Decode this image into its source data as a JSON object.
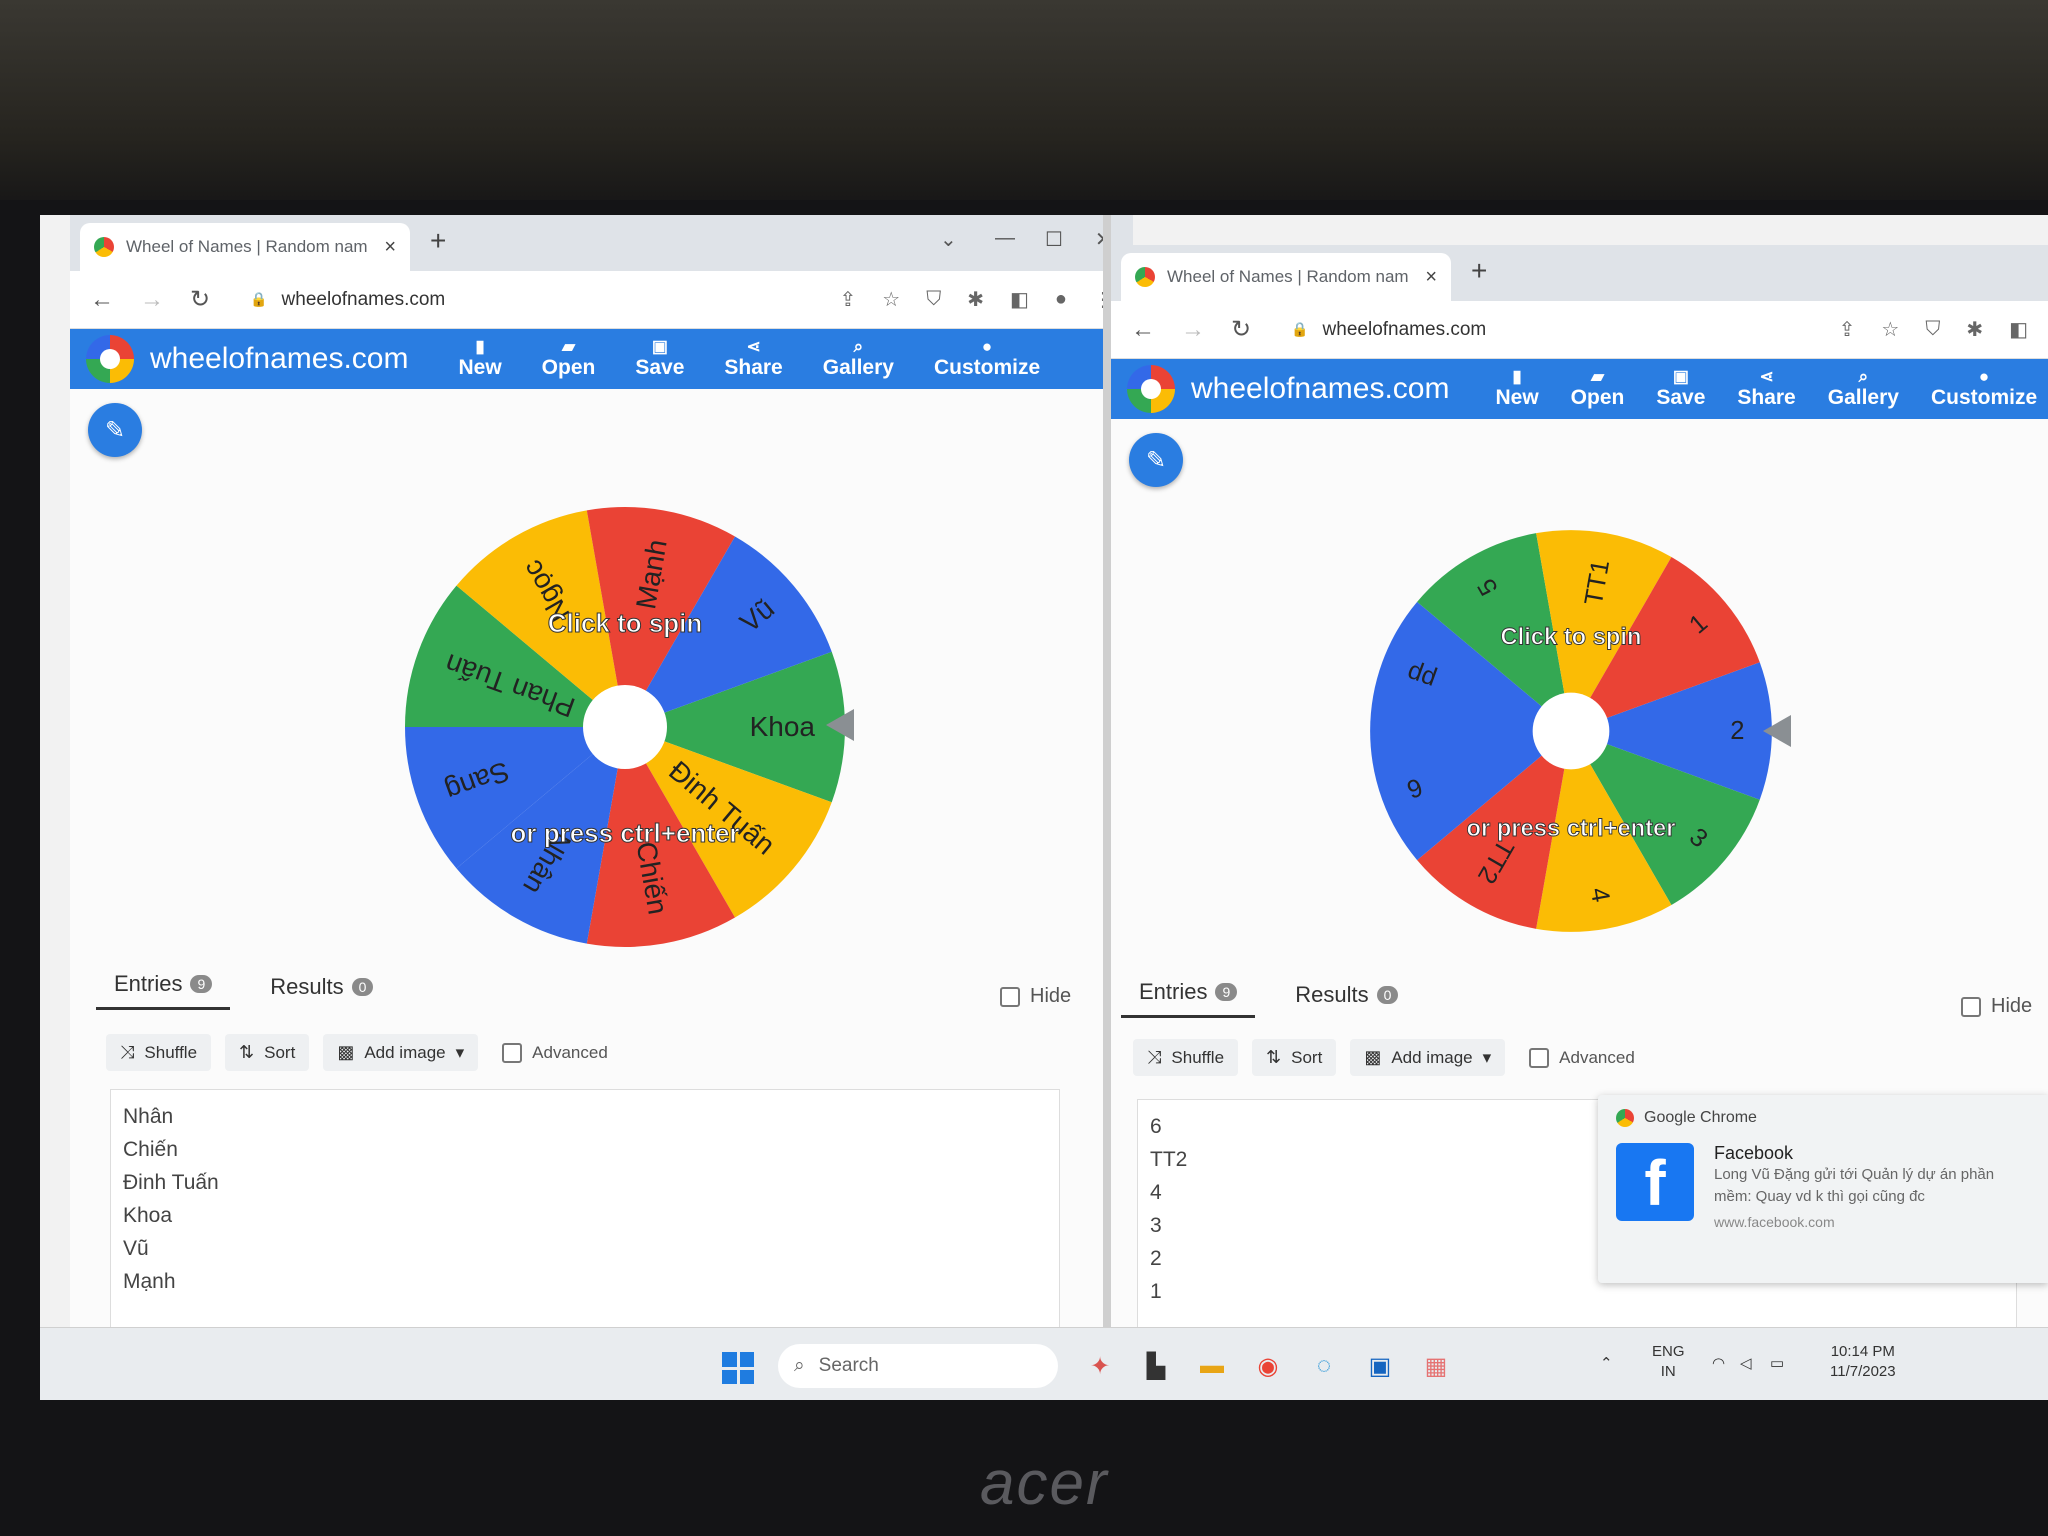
{
  "browser": {
    "tab_title": "Wheel of Names | Random nam",
    "url": "wheelofnames.com",
    "new_tab": "+",
    "close_tab": "×"
  },
  "app": {
    "brand": "wheelofnames.com",
    "menu": [
      {
        "label": "New",
        "icon": "file-icon"
      },
      {
        "label": "Open",
        "icon": "folder-icon"
      },
      {
        "label": "Save",
        "icon": "save-icon"
      },
      {
        "label": "Share",
        "icon": "share-icon"
      },
      {
        "label": "Gallery",
        "icon": "search-icon"
      },
      {
        "label": "Customize",
        "icon": "palette-icon"
      }
    ],
    "accent": "#2a7de1"
  },
  "left_window": {
    "wheel": {
      "top_text": "Click to spin",
      "bottom_text": "or press ctrl+enter",
      "segments": [
        {
          "label": "Khoa",
          "color": "#34a853"
        },
        {
          "label": "Đinh Tuấn",
          "color": "#fbbc05"
        },
        {
          "label": "Chiến",
          "color": "#ea4335"
        },
        {
          "label": "Nhân",
          "color": "#3369e8"
        },
        {
          "label": "Sang",
          "color": "#3369e8"
        },
        {
          "label": "Phan Tuấn",
          "color": "#34a853"
        },
        {
          "label": "Ngọc",
          "color": "#fbbc05"
        },
        {
          "label": "Mạnh",
          "color": "#ea4335"
        },
        {
          "label": "Vũ",
          "color": "#3369e8"
        }
      ]
    },
    "tabs": {
      "entries": "Entries",
      "entries_count": "9",
      "results": "Results",
      "results_count": "0"
    },
    "hide_label": "Hide",
    "toolbar": {
      "shuffle": "Shuffle",
      "sort": "Sort",
      "add_image": "Add image",
      "advanced": "Advanced"
    },
    "entries": [
      "Nhân",
      "Chiến",
      "Đinh Tuấn",
      "Khoa",
      "Vũ",
      "Mạnh"
    ]
  },
  "right_window": {
    "wheel": {
      "top_text": "Click to spin",
      "bottom_text": "or press ctrl+enter",
      "segments": [
        {
          "label": "2",
          "color": "#3369e8"
        },
        {
          "label": "3",
          "color": "#34a853"
        },
        {
          "label": "4",
          "color": "#fbbc05"
        },
        {
          "label": "TT2",
          "color": "#ea4335"
        },
        {
          "label": "6",
          "color": "#3369e8"
        },
        {
          "label": "pp",
          "color": "#3369e8"
        },
        {
          "label": "5",
          "color": "#34a853"
        },
        {
          "label": "TT1",
          "color": "#fbbc05"
        },
        {
          "label": "1",
          "color": "#ea4335"
        }
      ]
    },
    "tabs": {
      "entries": "Entries",
      "entries_count": "9",
      "results": "Results",
      "results_count": "0"
    },
    "hide_label": "Hide",
    "toolbar": {
      "shuffle": "Shuffle",
      "sort": "Sort",
      "add_image": "Add image",
      "advanced": "Advanced"
    },
    "entries": [
      "6",
      "TT2",
      "4",
      "3",
      "2",
      "1"
    ]
  },
  "notification": {
    "source": "Google Chrome",
    "title": "Facebook",
    "message": "Long Vũ Đặng gửi tới Quản lý dự án phần mềm: Quay vd k thì gọi cũng đc",
    "url": "www.facebook.com"
  },
  "taskbar": {
    "search": "Search",
    "lang": "ENG",
    "region": "IN",
    "time": "10:14 PM",
    "date": "11/7/2023"
  },
  "laptop_brand": "acer"
}
